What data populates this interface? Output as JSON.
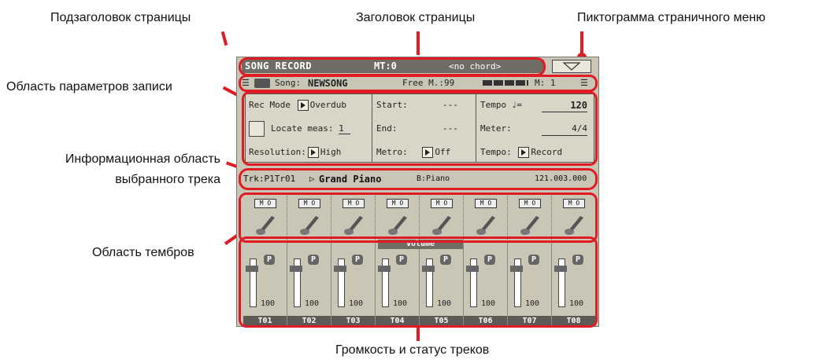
{
  "callouts": {
    "subtitle": "Подзаголовок страницы",
    "title": "Заголовок страницы",
    "menu_icon": "Пиктограмма страничного меню",
    "rec_params": "Область параметров записи",
    "track_info_1": "Информационная область",
    "track_info_2": "выбранного трека",
    "timbres": "Область тембров",
    "volume_status": "Громкость и статус треков"
  },
  "screen": {
    "header": {
      "title": "SONG RECORD",
      "mt": "MT:0",
      "chord": "<no chord>"
    },
    "subheader": {
      "song_label": "Song:",
      "song_name": "NEWSONG",
      "free_mem": "Free M.:99",
      "meas": "M: 1"
    },
    "rec": {
      "rec_mode_label": "Rec Mode",
      "rec_mode_value": "Overdub",
      "locate_label": "Locate meas:",
      "locate_value": "1",
      "resolution_label": "Resolution:",
      "resolution_value": "High",
      "start_label": "Start:",
      "start_value": "---",
      "end_label": "End:",
      "end_value": "---",
      "metro_label": "Metro:",
      "metro_value": "Off",
      "tempo_label": "Tempo",
      "tempo_symbol": "♩=",
      "tempo_value": "120",
      "meter_label": "Meter:",
      "meter_value": "4/4",
      "tempo_mode_label": "Tempo:",
      "tempo_mode_value": "Record"
    },
    "track": {
      "id": "Trk:P1Tr01",
      "sound": "Grand Piano",
      "bank": "B:Piano",
      "pos": "121.003.000"
    },
    "volume_label": "Volume",
    "tracks": [
      {
        "name": "T01",
        "volume": "100",
        "play": "P",
        "badge": "M O"
      },
      {
        "name": "T02",
        "volume": "100",
        "play": "P",
        "badge": "M O"
      },
      {
        "name": "T03",
        "volume": "100",
        "play": "P",
        "badge": "M O"
      },
      {
        "name": "T04",
        "volume": "100",
        "play": "P",
        "badge": "M O"
      },
      {
        "name": "T05",
        "volume": "100",
        "play": "P",
        "badge": "M O"
      },
      {
        "name": "T06",
        "volume": "100",
        "play": "P",
        "badge": "M O"
      },
      {
        "name": "T07",
        "volume": "100",
        "play": "P",
        "badge": "M O"
      },
      {
        "name": "T08",
        "volume": "100",
        "play": "P",
        "badge": "M O"
      }
    ]
  },
  "colors": {
    "accent": "#e01b24",
    "screen_bg": "#c9c6b6",
    "header_bg": "#6e6c65"
  }
}
